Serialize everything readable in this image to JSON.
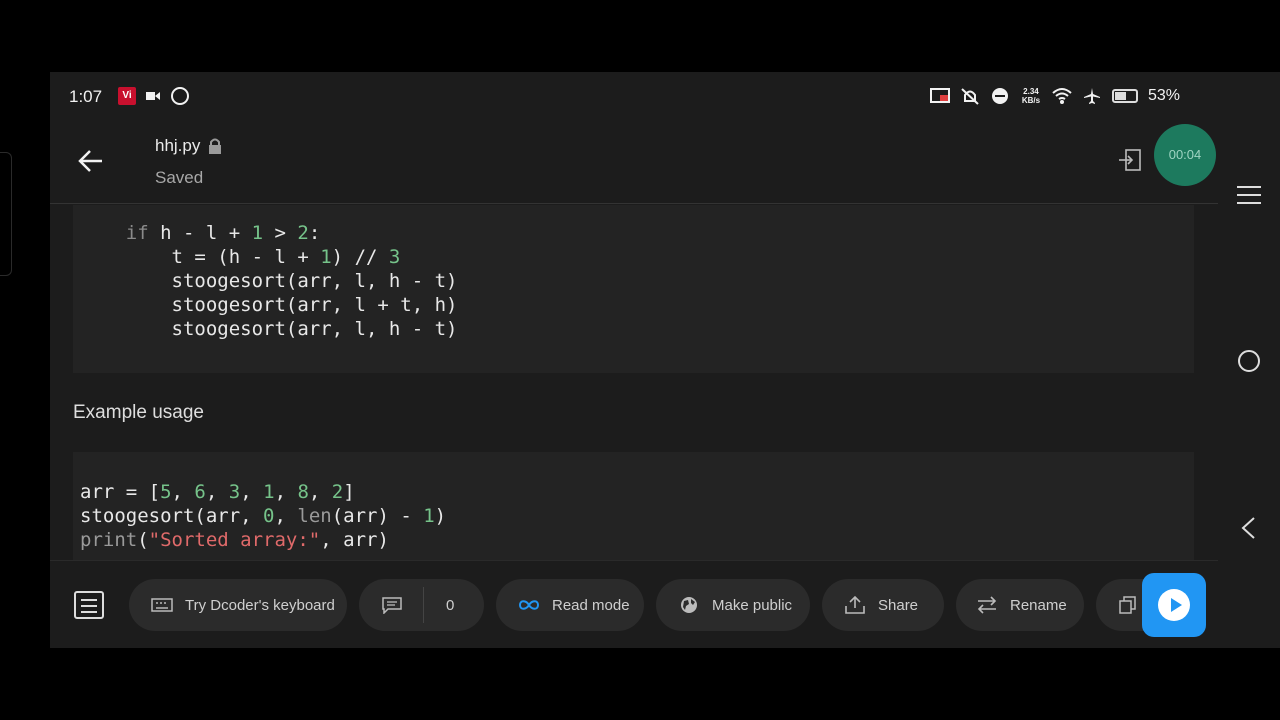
{
  "status": {
    "time": "1:07",
    "carrier_badge": "Vi",
    "speed_top": "2.34",
    "speed_bottom": "KB/s",
    "battery": "53%",
    "battery_level": 0.53
  },
  "header": {
    "file_name": "hhj.py",
    "save_status": "Saved",
    "timer": "00:04"
  },
  "code_block_1": {
    "lines": [
      [
        {
          "t": "    "
        },
        {
          "t": "if",
          "c": "kw"
        },
        {
          "t": " h - l + "
        },
        {
          "t": "1",
          "c": "num"
        },
        {
          "t": " > "
        },
        {
          "t": "2",
          "c": "num"
        },
        {
          "t": ":"
        }
      ],
      [
        {
          "t": "        t = (h - l + "
        },
        {
          "t": "1",
          "c": "num"
        },
        {
          "t": ") "
        },
        {
          "t": "//",
          "c": ""
        },
        {
          "t": " "
        },
        {
          "t": "3",
          "c": "num"
        }
      ],
      [
        {
          "t": "        stoogesort(arr, l, h - t)"
        }
      ],
      [
        {
          "t": "        stoogesort(arr, l + t, h)"
        }
      ],
      [
        {
          "t": "        stoogesort(arr, l, h - t)"
        }
      ]
    ]
  },
  "section": {
    "title": "Example usage"
  },
  "code_block_2": {
    "lines": [
      [
        {
          "t": "arr = ["
        },
        {
          "t": "5",
          "c": "num"
        },
        {
          "t": ", "
        },
        {
          "t": "6",
          "c": "num"
        },
        {
          "t": ", "
        },
        {
          "t": "3",
          "c": "num"
        },
        {
          "t": ", "
        },
        {
          "t": "1",
          "c": "num"
        },
        {
          "t": ", "
        },
        {
          "t": "8",
          "c": "num"
        },
        {
          "t": ", "
        },
        {
          "t": "2",
          "c": "num"
        },
        {
          "t": "]"
        }
      ],
      [
        {
          "t": "stoogesort(arr, "
        },
        {
          "t": "0",
          "c": "num"
        },
        {
          "t": ", "
        },
        {
          "t": "len",
          "c": "fn"
        },
        {
          "t": "(arr) - "
        },
        {
          "t": "1",
          "c": "num"
        },
        {
          "t": ")"
        }
      ],
      [
        {
          "t": "print",
          "c": "fn"
        },
        {
          "t": "("
        },
        {
          "t": "\"Sorted array:\"",
          "c": "str"
        },
        {
          "t": ", arr)"
        }
      ]
    ]
  },
  "toolbar": {
    "keyboard_label": "Try Dcoder's keyboard",
    "comment_count": "0",
    "read_mode_label": "Read mode",
    "make_public_label": "Make public",
    "share_label": "Share",
    "rename_label": "Rename"
  },
  "colors": {
    "accent": "#2196f3",
    "timer_bg": "#1d7a5e",
    "number": "#76c38a",
    "string": "#e06a6a",
    "keyword": "#8a8a8a"
  }
}
